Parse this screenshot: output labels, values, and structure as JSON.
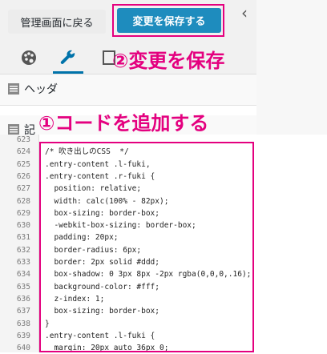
{
  "header": {
    "back_label": "管理画面に戻る",
    "save_label": "変更を保存する",
    "collapse_icon": "chevron-left"
  },
  "tabs": [
    {
      "icon": "palette",
      "active": false
    },
    {
      "icon": "wrench",
      "active": true
    },
    {
      "icon": "image",
      "active": false
    }
  ],
  "panels": [
    {
      "label": "ヘッダ"
    },
    {
      "label": "記"
    }
  ],
  "annotations": {
    "save": "②変更を保存",
    "add_code": "①コードを追加する",
    "color": "#e4007f"
  },
  "colors": {
    "accent": "#1e8cbe",
    "annotation": "#e4007f"
  },
  "editor": {
    "lines": [
      {
        "n": "623",
        "text": ""
      },
      {
        "n": "624",
        "text": "/* 吹き出しのCSS  */"
      },
      {
        "n": "625",
        "text": ".entry-content .l-fuki,"
      },
      {
        "n": "626",
        "text": ".entry-content .r-fuki {"
      },
      {
        "n": "627",
        "text": "  position: relative;"
      },
      {
        "n": "628",
        "text": "  width: calc(100% - 82px);"
      },
      {
        "n": "629",
        "text": "  box-sizing: border-box;"
      },
      {
        "n": "630",
        "text": "  -webkit-box-sizing: border-box;"
      },
      {
        "n": "631",
        "text": "  padding: 20px;"
      },
      {
        "n": "632",
        "text": "  border-radius: 6px;"
      },
      {
        "n": "633",
        "text": "  border: 2px solid #ddd;"
      },
      {
        "n": "634",
        "text": "  box-shadow: 0 3px 8px -2px rgba(0,0,0,.16);"
      },
      {
        "n": "635",
        "text": "  background-color: #fff;"
      },
      {
        "n": "636",
        "text": "  z-index: 1;"
      },
      {
        "n": "637",
        "text": "  box-sizing: border-box;"
      },
      {
        "n": "638",
        "text": "}"
      },
      {
        "n": "639",
        "text": ".entry-content .l-fuki {"
      },
      {
        "n": "640",
        "text": "  margin: 20px auto 36px 0;"
      }
    ]
  }
}
